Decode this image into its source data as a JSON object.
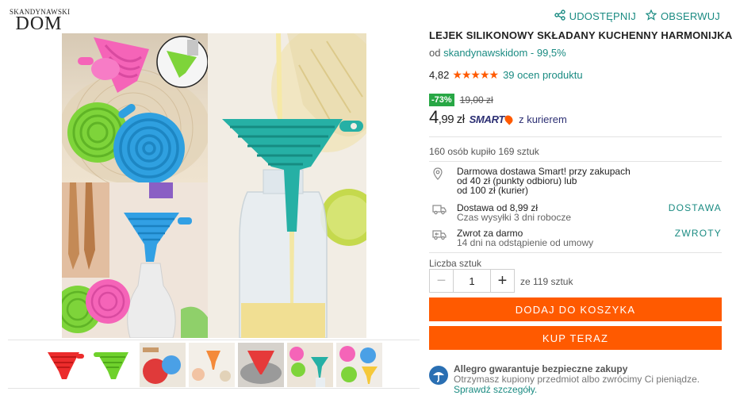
{
  "brand": {
    "line1": "SKANDYNAWSKI",
    "line2": "DOM"
  },
  "actions": {
    "share": "UDOSTĘPNIJ",
    "watch": "OBSERWUJ"
  },
  "product": {
    "title": "LEJEK SILIKONOWY SKŁADANY KUCHENNY HARMONIJKA",
    "seller_prefix": "od",
    "seller_name": "skandynawskidom - 99,5%",
    "rating": "4,82",
    "stars": "★★★★★",
    "rating_count": "39 ocen produktu",
    "discount": "-73%",
    "old_price": "19,00 zł",
    "price_main": "4",
    "price_cents": ",99 zł",
    "smart_label": "SMART",
    "courier": "z kurierem",
    "bought": "160 osób kupiło 169 sztuk"
  },
  "delivery": {
    "free_line1": "Darmowa dostawa Smart! przy zakupach",
    "free_line2": "od 40 zł (punkty odbioru) lub",
    "free_line3": "od 100 zł (kurier)",
    "shipping_title": "Dostawa od 8,99 zł",
    "shipping_sub": "Czas wysyłki 3 dni robocze",
    "shipping_link": "DOSTAWA",
    "return_title": "Zwrot za darmo",
    "return_sub": "14 dni na odstąpienie od umowy",
    "return_link": "ZWROTY"
  },
  "quantity": {
    "label": "Liczba sztuk",
    "value": "1",
    "minus": "−",
    "plus": "+",
    "of": "ze 119 sztuk"
  },
  "buttons": {
    "add_to_cart": "DODAJ DO KOSZYKA",
    "buy_now": "KUP TERAZ"
  },
  "guarantee": {
    "title": "Allegro gwarantuje bezpieczne zakupy",
    "text": "Otrzymasz kupiony przedmiot albo zwrócimy Ci pieniądze.",
    "link": "Sprawdź szczegóły."
  },
  "colors": {
    "accent": "#1a8b82",
    "cta": "#ff5a00",
    "discount": "#28a745",
    "smart": "#2c2f73"
  },
  "thumbnails": [
    "red-funnel",
    "green-funnel",
    "funnel-pair",
    "funnel-kitchen",
    "red-funnel-in-pot",
    "funnel-collage",
    "funnel-set"
  ]
}
